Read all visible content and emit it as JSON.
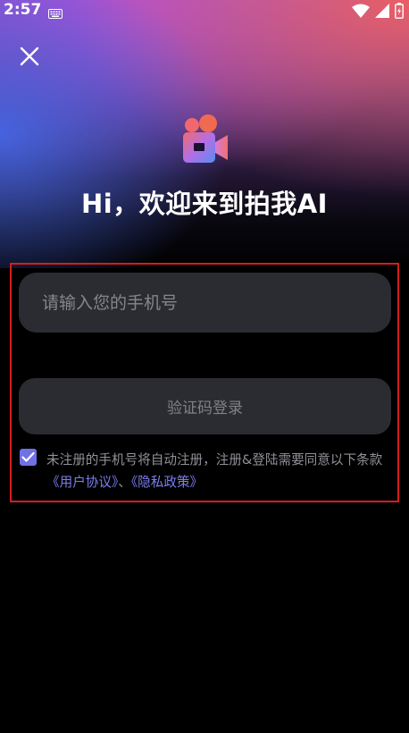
{
  "status_bar": {
    "time": "2:57",
    "icons": [
      "keyboard-icon",
      "wifi-icon",
      "signal-icon",
      "battery-icon"
    ]
  },
  "header": {
    "close_icon": "close-icon",
    "logo_icon": "video-camera-logo-icon",
    "title": "Hi，欢迎来到拍我AI"
  },
  "form": {
    "phone_placeholder": "请输入您的手机号",
    "phone_value": "",
    "login_button_label": "验证码登录",
    "agreement": {
      "checked": true,
      "text": "未注册的手机号将自动注册，注册&登陆需要同意以下条款",
      "user_agreement_link": "《用户协议》",
      "separator": "、",
      "privacy_link": "《隐私政策》"
    }
  },
  "colors": {
    "background": "#000000",
    "input_background": "#2b2c31",
    "accent": "#6f72e3",
    "link": "#7b7ef0",
    "highlight_border": "#d81c1c",
    "logo_gradient": [
      "#f06a6a",
      "#b36ee6",
      "#5a8cf0"
    ]
  }
}
